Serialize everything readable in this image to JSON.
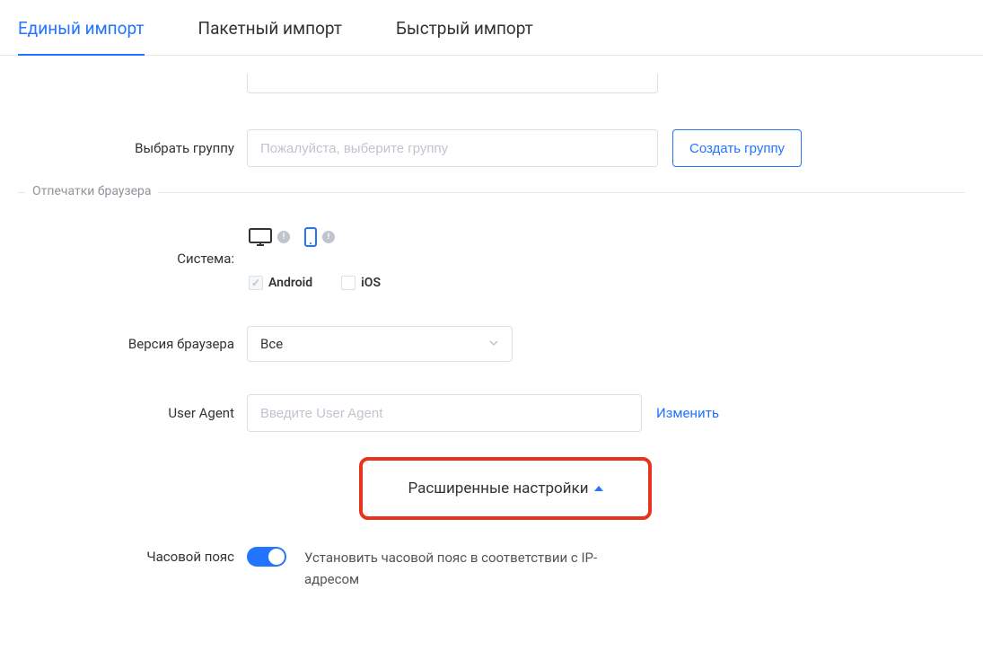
{
  "tabs": {
    "single": "Единый импорт",
    "batch": "Пакетный импорт",
    "quick": "Быстрый импорт"
  },
  "group": {
    "label": "Выбрать группу",
    "placeholder": "Пожалуйста, выберите группу",
    "createBtn": "Создать группу"
  },
  "fingerprints": {
    "legend": "Отпечатки браузера",
    "systemLabel": "Система:",
    "android": "Android",
    "ios": "iOS",
    "browserVersionLabel": "Версия браузера",
    "browserVersionValue": "Все",
    "userAgentLabel": "User Agent",
    "userAgentPlaceholder": "Введите User Agent",
    "changeLink": "Изменить",
    "advancedLabel": "Расширенные настройки",
    "timezoneLabel": "Часовой пояс",
    "timezoneText": "Установить часовой пояс в соответствии с IP-адресом"
  }
}
